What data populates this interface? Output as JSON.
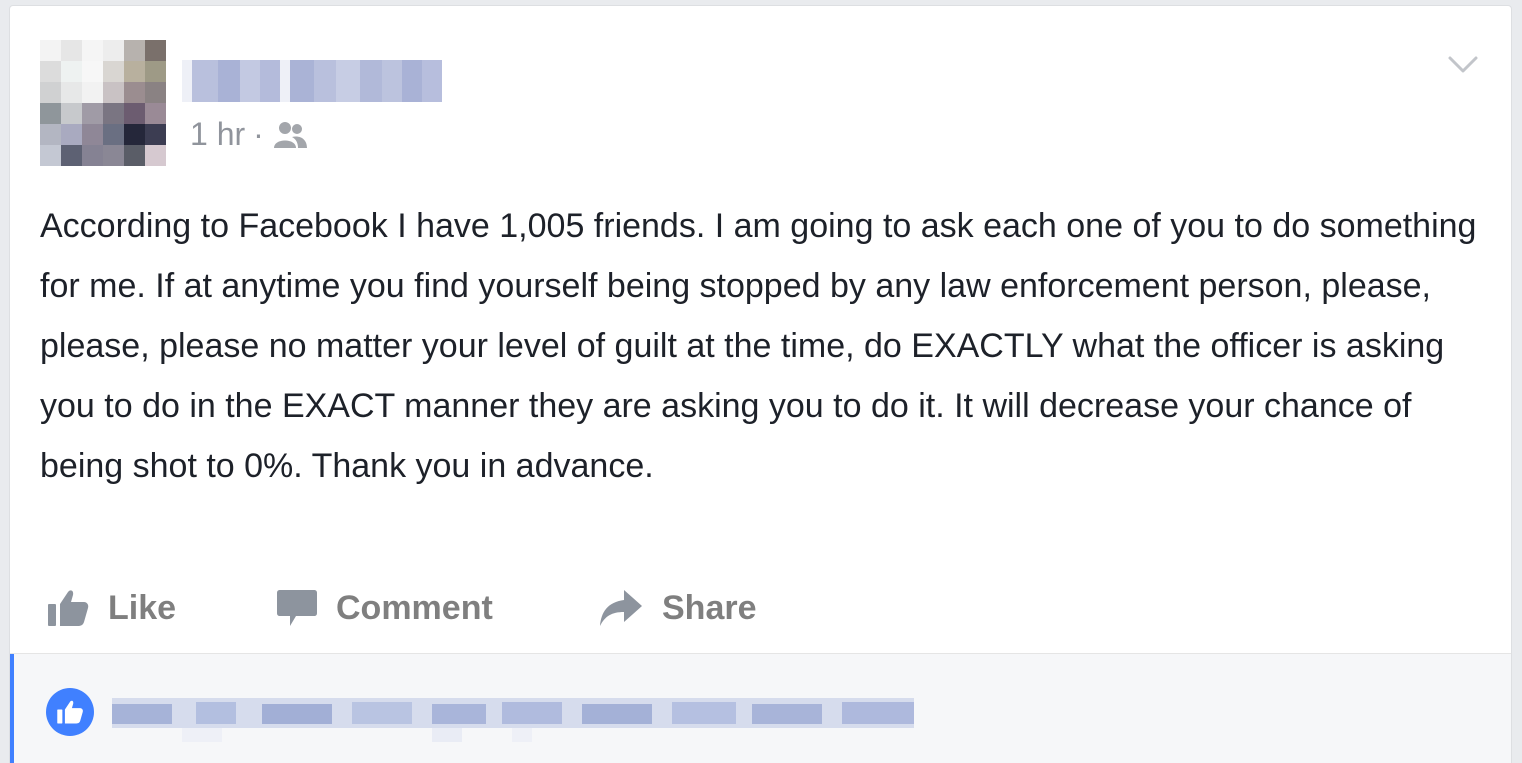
{
  "post": {
    "timestamp": "1 hr",
    "separator": "·",
    "audience_icon": "friends-icon",
    "menu_icon": "chevron-down-icon",
    "text": "According to Facebook I have 1,005 friends. I am going to ask each one of you to do something for me. If at anytime you find yourself being stopped by any law enforcement person, please, please, please no matter your level of guilt at the time, do EXACTLY what the officer is asking you to do in the EXACT manner they are asking you to do it. It will decrease your chance of being shot to 0%. Thank you in advance."
  },
  "actions": {
    "like_label": "Like",
    "comment_label": "Comment",
    "share_label": "Share"
  },
  "reactions": {
    "reaction_icon": "thumbs-up-icon"
  },
  "colors": {
    "accent": "#4080ff",
    "text": "#1d2129",
    "muted": "#90949c",
    "action": "#7f7f7f"
  }
}
